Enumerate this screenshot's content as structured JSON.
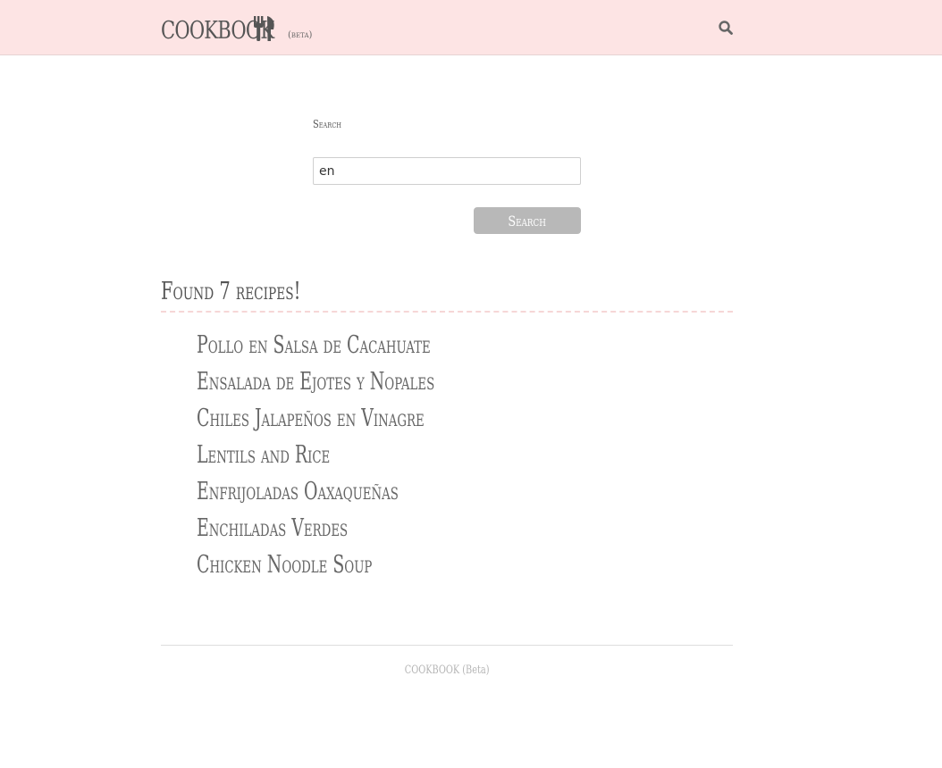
{
  "navbar": {
    "brand_text": "COOKBOOK",
    "brand_icon": "utensils-icon",
    "beta_label": "(beta)",
    "search_icon": "search-icon",
    "background": "#fde4e4"
  },
  "search": {
    "label": "Search",
    "input_value": "en",
    "button_label": "Search",
    "button_color": "#b8b8b8"
  },
  "results": {
    "heading": "Found 7 recipes!",
    "recipes": [
      "Pollo en Salsa de Cacahuate",
      "Ensalada de Ejotes y Nopales",
      "Chiles Jalapeños en Vinagre",
      "Lentils and Rice",
      "Enfrijoladas Oaxaqueñas",
      "Enchiladas Verdes",
      "Chicken Noodle Soup"
    ]
  },
  "footer": {
    "text": "COOKBOOK (Beta)"
  }
}
